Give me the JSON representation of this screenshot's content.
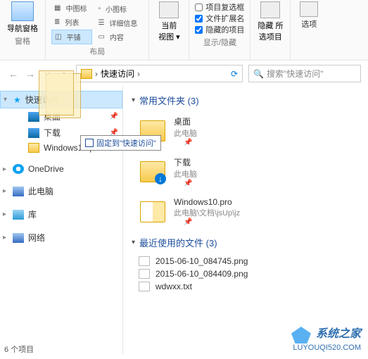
{
  "ribbon": {
    "groups": {
      "pane": {
        "nav_pane": "导航窗格",
        "title": "窗格"
      },
      "layout": {
        "items": {
          "mid": "中图标",
          "small": "小图标",
          "tile": "平铺",
          "list": "列表",
          "detail": "详细信息",
          "content": "内容"
        },
        "title": "布局"
      },
      "current_view": {
        "top": "当前",
        "bottom": "视图",
        "title": ""
      },
      "show_hide": {
        "checks": {
          "checkboxes": "项目复选框",
          "ext": "文件扩展名",
          "hidden": "隐藏的项目"
        },
        "hide_btn": "隐藏\n所选项目",
        "title": "显示/隐藏"
      },
      "options": {
        "label": "选项"
      }
    }
  },
  "nav": {
    "breadcrumb": {
      "root": "快速访问",
      "sep": "›"
    },
    "search_placeholder": "搜索\"快速访问\""
  },
  "sidebar": {
    "quick": "快速访问",
    "desktop": "桌面",
    "downloads": "下载",
    "win10": "Windows10.pro",
    "onedrive": "OneDrive",
    "thispc": "此电脑",
    "libraries": "库",
    "network": "网络"
  },
  "tooltip": "固定到\"快速访问\"",
  "content": {
    "frequent": {
      "title": "常用文件夹 (3)",
      "items": [
        {
          "name": "桌面",
          "sub": "此电脑"
        },
        {
          "name": "下载",
          "sub": "此电脑"
        },
        {
          "name": "Windows10.pro",
          "sub": "此电脑\\文档\\jsUp\\jz"
        }
      ]
    },
    "recent": {
      "title": "最近使用的文件 (3)",
      "items": [
        "2015-06-10_084745.png",
        "2015-06-10_084409.png",
        "wdwxx.txt"
      ]
    }
  },
  "status": "6 个项目",
  "watermark": {
    "line1": "系统之家",
    "line2": "LUYOUQI520.COM"
  }
}
